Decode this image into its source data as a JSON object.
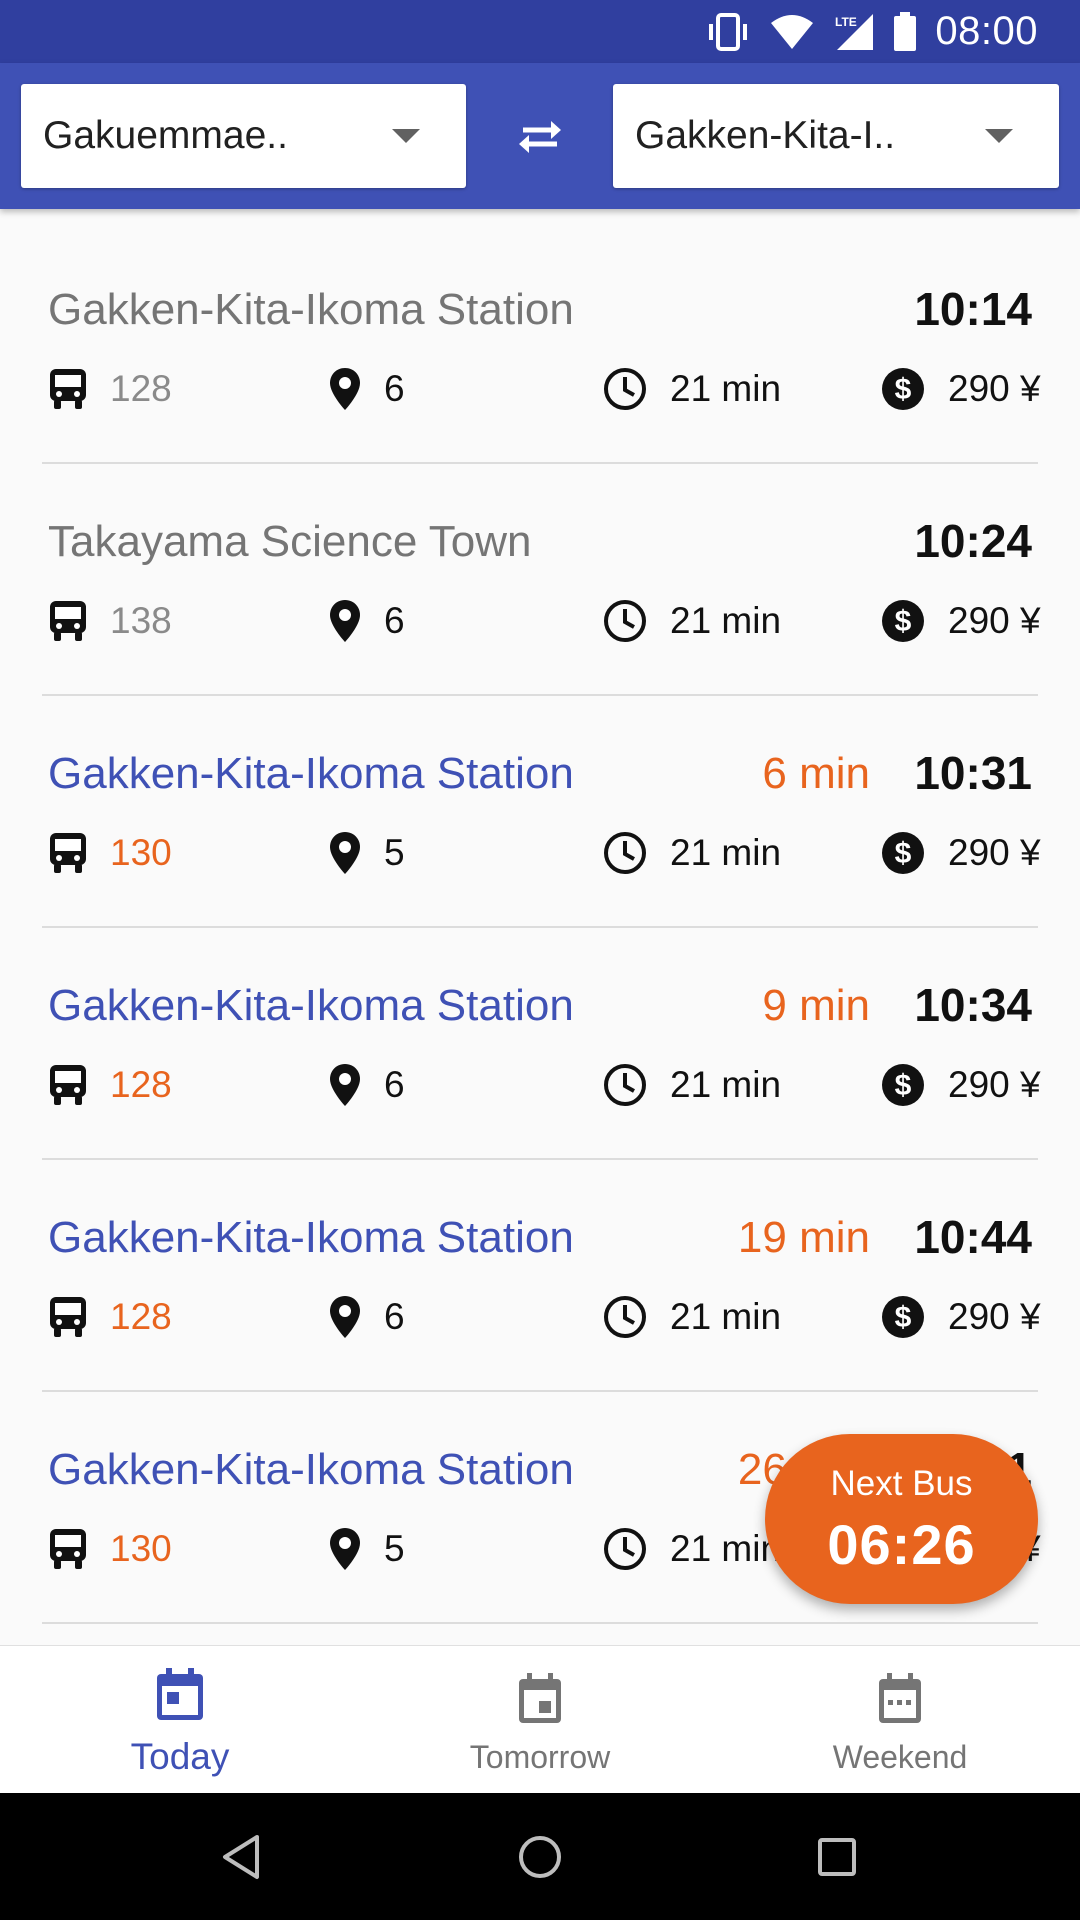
{
  "status_bar": {
    "time": "08:00",
    "network": "LTE"
  },
  "header": {
    "from_stop": "Gakuemmae..",
    "to_stop": "Gakken-Kita-I..",
    "swap_icon": "swap-horiz-icon"
  },
  "departures": [
    {
      "destination": "Gakken-Kita-Ikoma Station",
      "state": "past",
      "eta": "",
      "time": "10:14",
      "route": "128",
      "stops": "6",
      "duration": "21 min",
      "fare": "290 ¥"
    },
    {
      "destination": "Takayama Science Town",
      "state": "past",
      "eta": "",
      "time": "10:24",
      "route": "138",
      "stops": "6",
      "duration": "21 min",
      "fare": "290 ¥"
    },
    {
      "destination": "Gakken-Kita-Ikoma Station",
      "state": "upcoming",
      "eta": "6 min",
      "time": "10:31",
      "route": "130",
      "stops": "5",
      "duration": "21 min",
      "fare": "290 ¥"
    },
    {
      "destination": "Gakken-Kita-Ikoma Station",
      "state": "upcoming",
      "eta": "9 min",
      "time": "10:34",
      "route": "128",
      "stops": "6",
      "duration": "21 min",
      "fare": "290 ¥"
    },
    {
      "destination": "Gakken-Kita-Ikoma Station",
      "state": "upcoming",
      "eta": "19 min",
      "time": "10:44",
      "route": "128",
      "stops": "6",
      "duration": "21 min",
      "fare": "290 ¥"
    },
    {
      "destination": "Gakken-Kita-Ikoma Station",
      "state": "upcoming",
      "eta": "26 min",
      "time": "10:51",
      "route": "130",
      "stops": "5",
      "duration": "21 min",
      "fare": "290 ¥"
    }
  ],
  "fab": {
    "label": "Next Bus",
    "time": "06:26"
  },
  "bottom_nav": {
    "items": [
      {
        "label": "Today",
        "icon": "calendar-today-icon",
        "active": true
      },
      {
        "label": "Tomorrow",
        "icon": "calendar-event-icon",
        "active": false
      },
      {
        "label": "Weekend",
        "icon": "calendar-week-icon",
        "active": false
      }
    ]
  },
  "colors": {
    "primary": "#3f51b5",
    "primary_dark": "#303f9f",
    "accent": "#e8641e",
    "past_text": "#757575"
  }
}
